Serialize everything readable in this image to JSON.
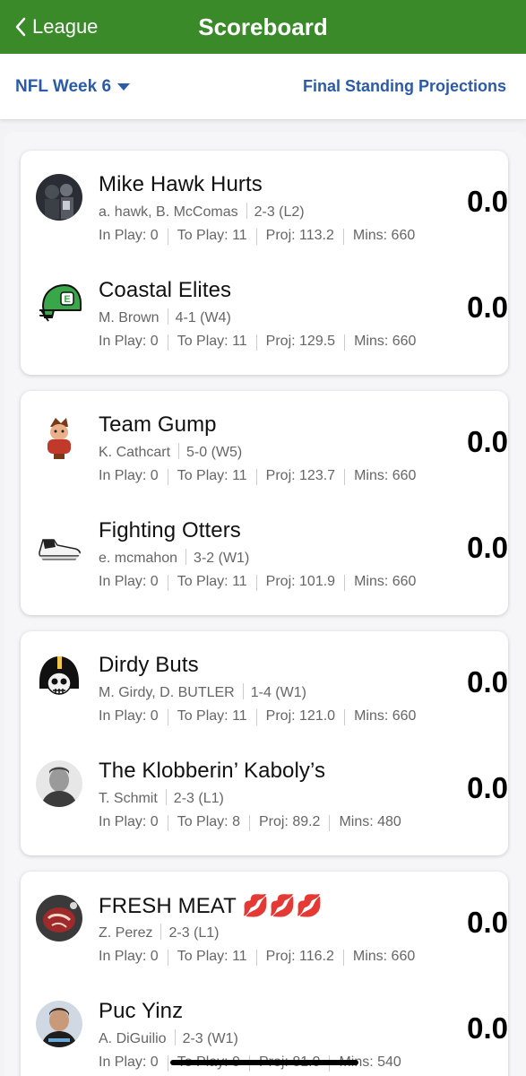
{
  "header": {
    "back_label": "League",
    "title": "Scoreboard"
  },
  "subheader": {
    "week_label": "NFL Week 6",
    "projections_label": "Final Standing Projections"
  },
  "matchups": [
    {
      "teams": [
        {
          "name": "Mike Hawk Hurts",
          "owners": "a. hawk, B. McComas",
          "record": "2-3 (L2)",
          "in_play": "In Play: 0",
          "to_play": "To Play: 11",
          "proj": "Proj: 113.2",
          "mins": "Mins: 660",
          "score": "0.0",
          "avatar": "photo-dark-avatar"
        },
        {
          "name": "Coastal Elites",
          "owners": "M. Brown",
          "record": "4-1 (W4)",
          "in_play": "In Play: 0",
          "to_play": "To Play: 11",
          "proj": "Proj: 129.5",
          "mins": "Mins: 660",
          "score": "0.0",
          "avatar": "green-helmet-avatar"
        }
      ]
    },
    {
      "teams": [
        {
          "name": "Team Gump",
          "owners": "K. Cathcart",
          "record": "5-0 (W5)",
          "in_play": "In Play: 0",
          "to_play": "To Play: 11",
          "proj": "Proj: 123.7",
          "mins": "Mins: 660",
          "score": "0.0",
          "avatar": "cartoon-character-avatar"
        },
        {
          "name": "Fighting Otters",
          "owners": "e. mcmahon",
          "record": "3-2 (W1)",
          "in_play": "In Play: 0",
          "to_play": "To Play: 11",
          "proj": "Proj: 101.9",
          "mins": "Mins: 660",
          "score": "0.0",
          "avatar": "sneaker-avatar"
        }
      ]
    },
    {
      "teams": [
        {
          "name": "Dirdy Buts",
          "owners": "M. Girdy, D. BUTLER",
          "record": "1-4 (W1)",
          "in_play": "In Play: 0",
          "to_play": "To Play: 11",
          "proj": "Proj: 121.0",
          "mins": "Mins: 660",
          "score": "0.0",
          "avatar": "skull-helmet-avatar"
        },
        {
          "name": "The Klobberin’ Kaboly’s",
          "owners": "T. Schmit",
          "record": "2-3 (L1)",
          "in_play": "In Play: 0",
          "to_play": "To Play: 8",
          "proj": "Proj: 89.2",
          "mins": "Mins: 480",
          "score": "0.0",
          "avatar": "person-photo-avatar"
        }
      ]
    },
    {
      "teams": [
        {
          "name": "FRESH MEAT 💋💋💋",
          "owners": "Z. Perez",
          "record": "2-3 (L1)",
          "in_play": "In Play: 0",
          "to_play": "To Play: 11",
          "proj": "Proj: 116.2",
          "mins": "Mins: 660",
          "score": "0.0",
          "avatar": "steak-avatar"
        },
        {
          "name": "Puc Yinz",
          "owners": "A. DiGuilio",
          "record": "2-3 (W1)",
          "in_play": "In Play: 0",
          "to_play": "To Play: 9",
          "proj": "Proj: 81.0",
          "mins": "Mins: 540",
          "score": "0.0",
          "avatar": "person-photo-avatar"
        }
      ]
    }
  ],
  "colors": {
    "header_green": "#3b8a2a",
    "link_blue": "#2b5ba8"
  }
}
